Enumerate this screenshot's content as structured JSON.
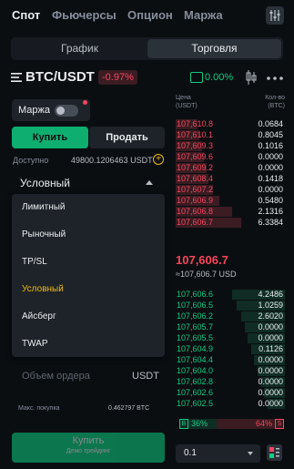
{
  "nav": {
    "tabs": [
      "Спот",
      "Фьючерсы",
      "Опцион",
      "Маржа"
    ],
    "active_index": 0
  },
  "view_toggle": {
    "chart": "График",
    "trade": "Торговля"
  },
  "pair": {
    "symbol": "BTC/USDT",
    "change": "-0.97%",
    "mini_pct": "0.00%"
  },
  "order_form": {
    "margin_label": "Маржа",
    "buy_label": "Купить",
    "sell_label": "Продать",
    "available_label": "Доступно",
    "available_value": "49800.1206463 USDT",
    "order_type": "Условный",
    "order_type_options": [
      "Лимитный",
      "Рыночный",
      "TP/SL",
      "Условный",
      "Айсберг",
      "TWAP"
    ],
    "order_type_selected": 3,
    "amount_placeholder": "Объем ордера",
    "amount_unit": "USDT",
    "max_buy_label": "Макс. покупка",
    "max_buy_value": "0.462797 BTC",
    "submit_label": "Купить",
    "submit_sub": "Демо трейдинг"
  },
  "order_book": {
    "price_header": "Цена\n(USDT)",
    "qty_header": "Кол-во\n(BTC)",
    "asks": [
      {
        "price": "107,610.8",
        "qty": "0.0684",
        "depth": 0.2
      },
      {
        "price": "107,610.1",
        "qty": "0.8045",
        "depth": 0.22
      },
      {
        "price": "107,609.3",
        "qty": "0.1016",
        "depth": 0.24
      },
      {
        "price": "107,609.6",
        "qty": "0.0000",
        "depth": 0.26
      },
      {
        "price": "107,609.2",
        "qty": "0.0000",
        "depth": 0.28
      },
      {
        "price": "107,608.4",
        "qty": "0.1418",
        "depth": 0.3
      },
      {
        "price": "107,607.2",
        "qty": "0.0000",
        "depth": 0.34
      },
      {
        "price": "107,606.9",
        "qty": "0.5480",
        "depth": 0.4
      },
      {
        "price": "107,606.8",
        "qty": "2.1316",
        "depth": 0.52
      },
      {
        "price": "107,606.7",
        "qty": "6.3384",
        "depth": 0.6
      }
    ],
    "last_price": "107,606.7",
    "last_usd": "≈107,606.7 USD",
    "bids": [
      {
        "price": "107,606.6",
        "qty": "4.2486",
        "depth": 0.48
      },
      {
        "price": "107,606.5",
        "qty": "1.0259",
        "depth": 0.44
      },
      {
        "price": "107,606.2",
        "qty": "2.6020",
        "depth": 0.4
      },
      {
        "price": "107,605.7",
        "qty": "0.0000",
        "depth": 0.37
      },
      {
        "price": "107,605.5",
        "qty": "0.0000",
        "depth": 0.34
      },
      {
        "price": "107,604.9",
        "qty": "0.1126",
        "depth": 0.31
      },
      {
        "price": "107,604.4",
        "qty": "0.0000",
        "depth": 0.28
      },
      {
        "price": "107,604.0",
        "qty": "0.0000",
        "depth": 0.25
      },
      {
        "price": "107,602.8",
        "qty": "0.0000",
        "depth": 0.22
      },
      {
        "price": "107,602.6",
        "qty": "0.0000",
        "depth": 0.19
      },
      {
        "price": "107,602.5",
        "qty": "0.0000",
        "depth": 0.16
      }
    ],
    "buy_ratio": "36%",
    "sell_ratio": "64%",
    "buy_ratio_value": 0.36,
    "buy_badge": "B",
    "sell_badge": "S",
    "step": "0.1"
  },
  "colors": {
    "green": "#0ecb81",
    "red": "#f6465d",
    "accent": "#f0b90b"
  }
}
